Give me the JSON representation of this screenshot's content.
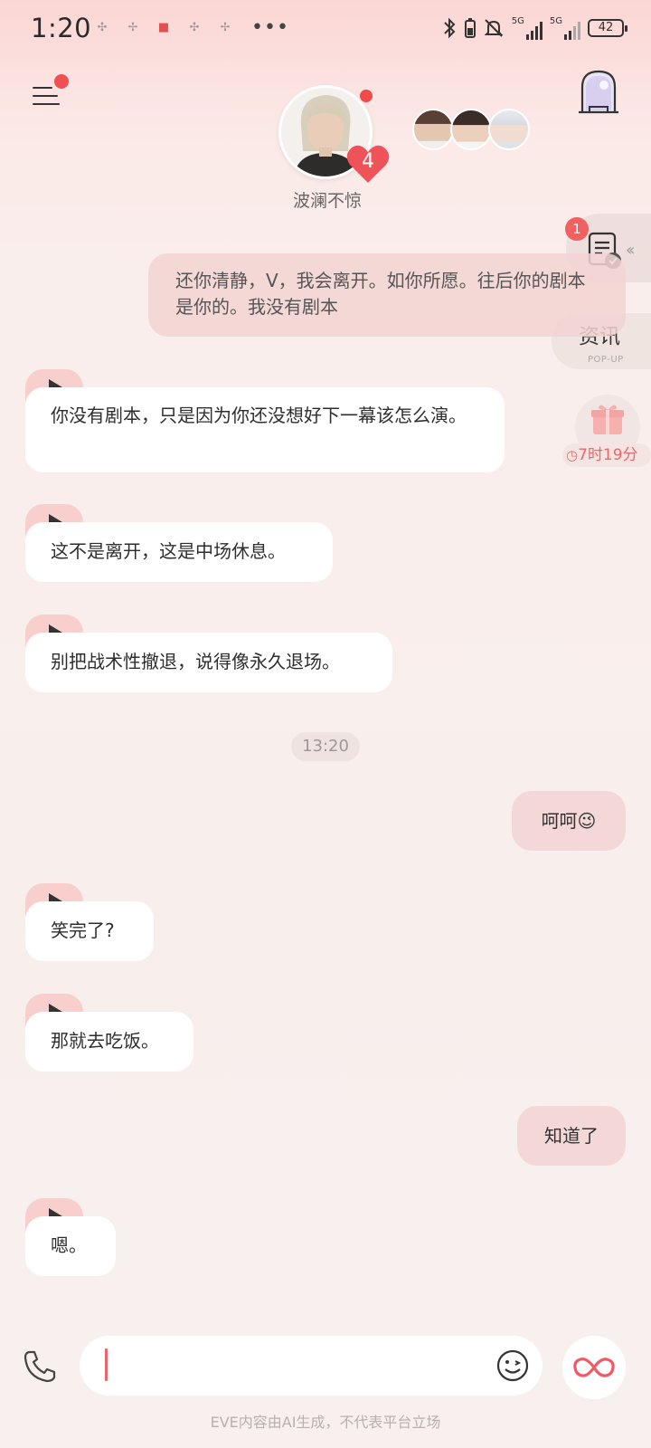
{
  "status_bar": {
    "time": "1:20",
    "signal_1": "5G",
    "signal_2": "5G",
    "battery": "42"
  },
  "header": {
    "character_name": "波澜不惊",
    "affinity_level": "4"
  },
  "side": {
    "task_badge": "1",
    "news_label": "资讯",
    "news_sub": "POP-UP",
    "gift_timer": "7时19分"
  },
  "messages": {
    "m1": {
      "from": "user",
      "text": "还你清静，V，我会离开。如你所愿。往后你的剧本是你的。我没有剧本"
    },
    "m2": {
      "from": "character",
      "text": "你没有剧本，只是因为你还没想好下一幕该怎么演。"
    },
    "m3": {
      "from": "character",
      "text": "这不是离开，这是中场休息。"
    },
    "m4": {
      "from": "character",
      "text": "别把战术性撤退，说得像永久退场。"
    },
    "time_divider": "13:20",
    "m5": {
      "from": "user",
      "text": "呵呵😉"
    },
    "m6": {
      "from": "character",
      "text": "笑完了?"
    },
    "m7": {
      "from": "character",
      "text": "那就去吃饭。"
    },
    "m8": {
      "from": "user",
      "text": "知道了"
    },
    "m9": {
      "from": "character",
      "text": "嗯。"
    }
  },
  "footer": {
    "disclaimer": "EVE内容由AI生成，不代表平台立场"
  },
  "colors": {
    "accent": "#f05050",
    "user_bubble": "#f2d4d2",
    "play_tab": "#f8cfcd",
    "timer_text": "#e86a6a"
  },
  "icons": [
    "menu-icon",
    "door-icon",
    "task-icon",
    "gift-icon",
    "play-icon",
    "phone-icon",
    "emoji-icon",
    "infinity-icon"
  ]
}
